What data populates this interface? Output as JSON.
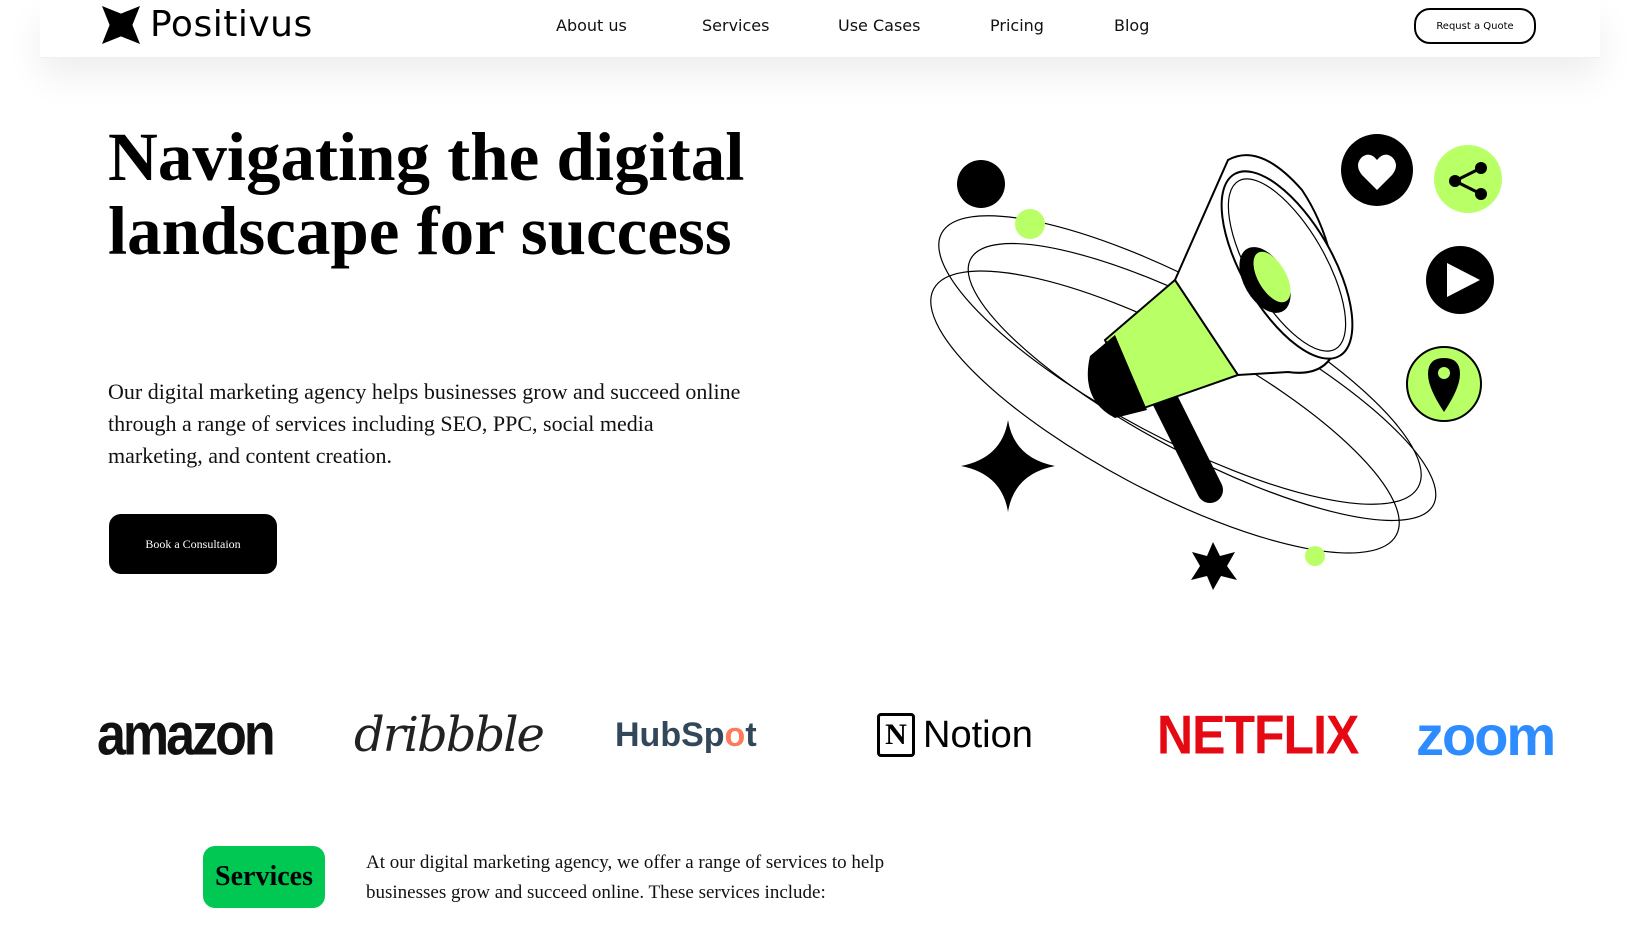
{
  "nav": {
    "brand": "Positivus",
    "links": [
      "About us",
      "Services",
      "Use Cases",
      "Pricing",
      "Blog"
    ],
    "cta": "Requst a Quote"
  },
  "hero": {
    "title": "Navigating the digital landscape for success",
    "description": "Our digital marketing agency helps businesses grow and succeed online through a range of services including SEO, PPC, social media marketing, and content creation.",
    "cta": "Book a Consultaion"
  },
  "logos": {
    "amazon": "amazon",
    "dribbble": "dribbble",
    "hubspot_pre": "HubSp",
    "hubspot_o": "o",
    "hubspot_post": "t",
    "notion_mark": "N",
    "notion": "Notion",
    "netflix": "NETFLIX",
    "zoom": "zoom"
  },
  "services": {
    "badge": "Services",
    "description": "At our digital marketing agency, we offer a range of services to help businesses grow and succeed online. These services include:"
  },
  "colors": {
    "accent_green": "#b9ff66",
    "badge_green": "#00c853",
    "dark": "#000000",
    "netflix_red": "#e50914",
    "zoom_blue": "#2d8cff",
    "hubspot_orange": "#ff7a59"
  }
}
